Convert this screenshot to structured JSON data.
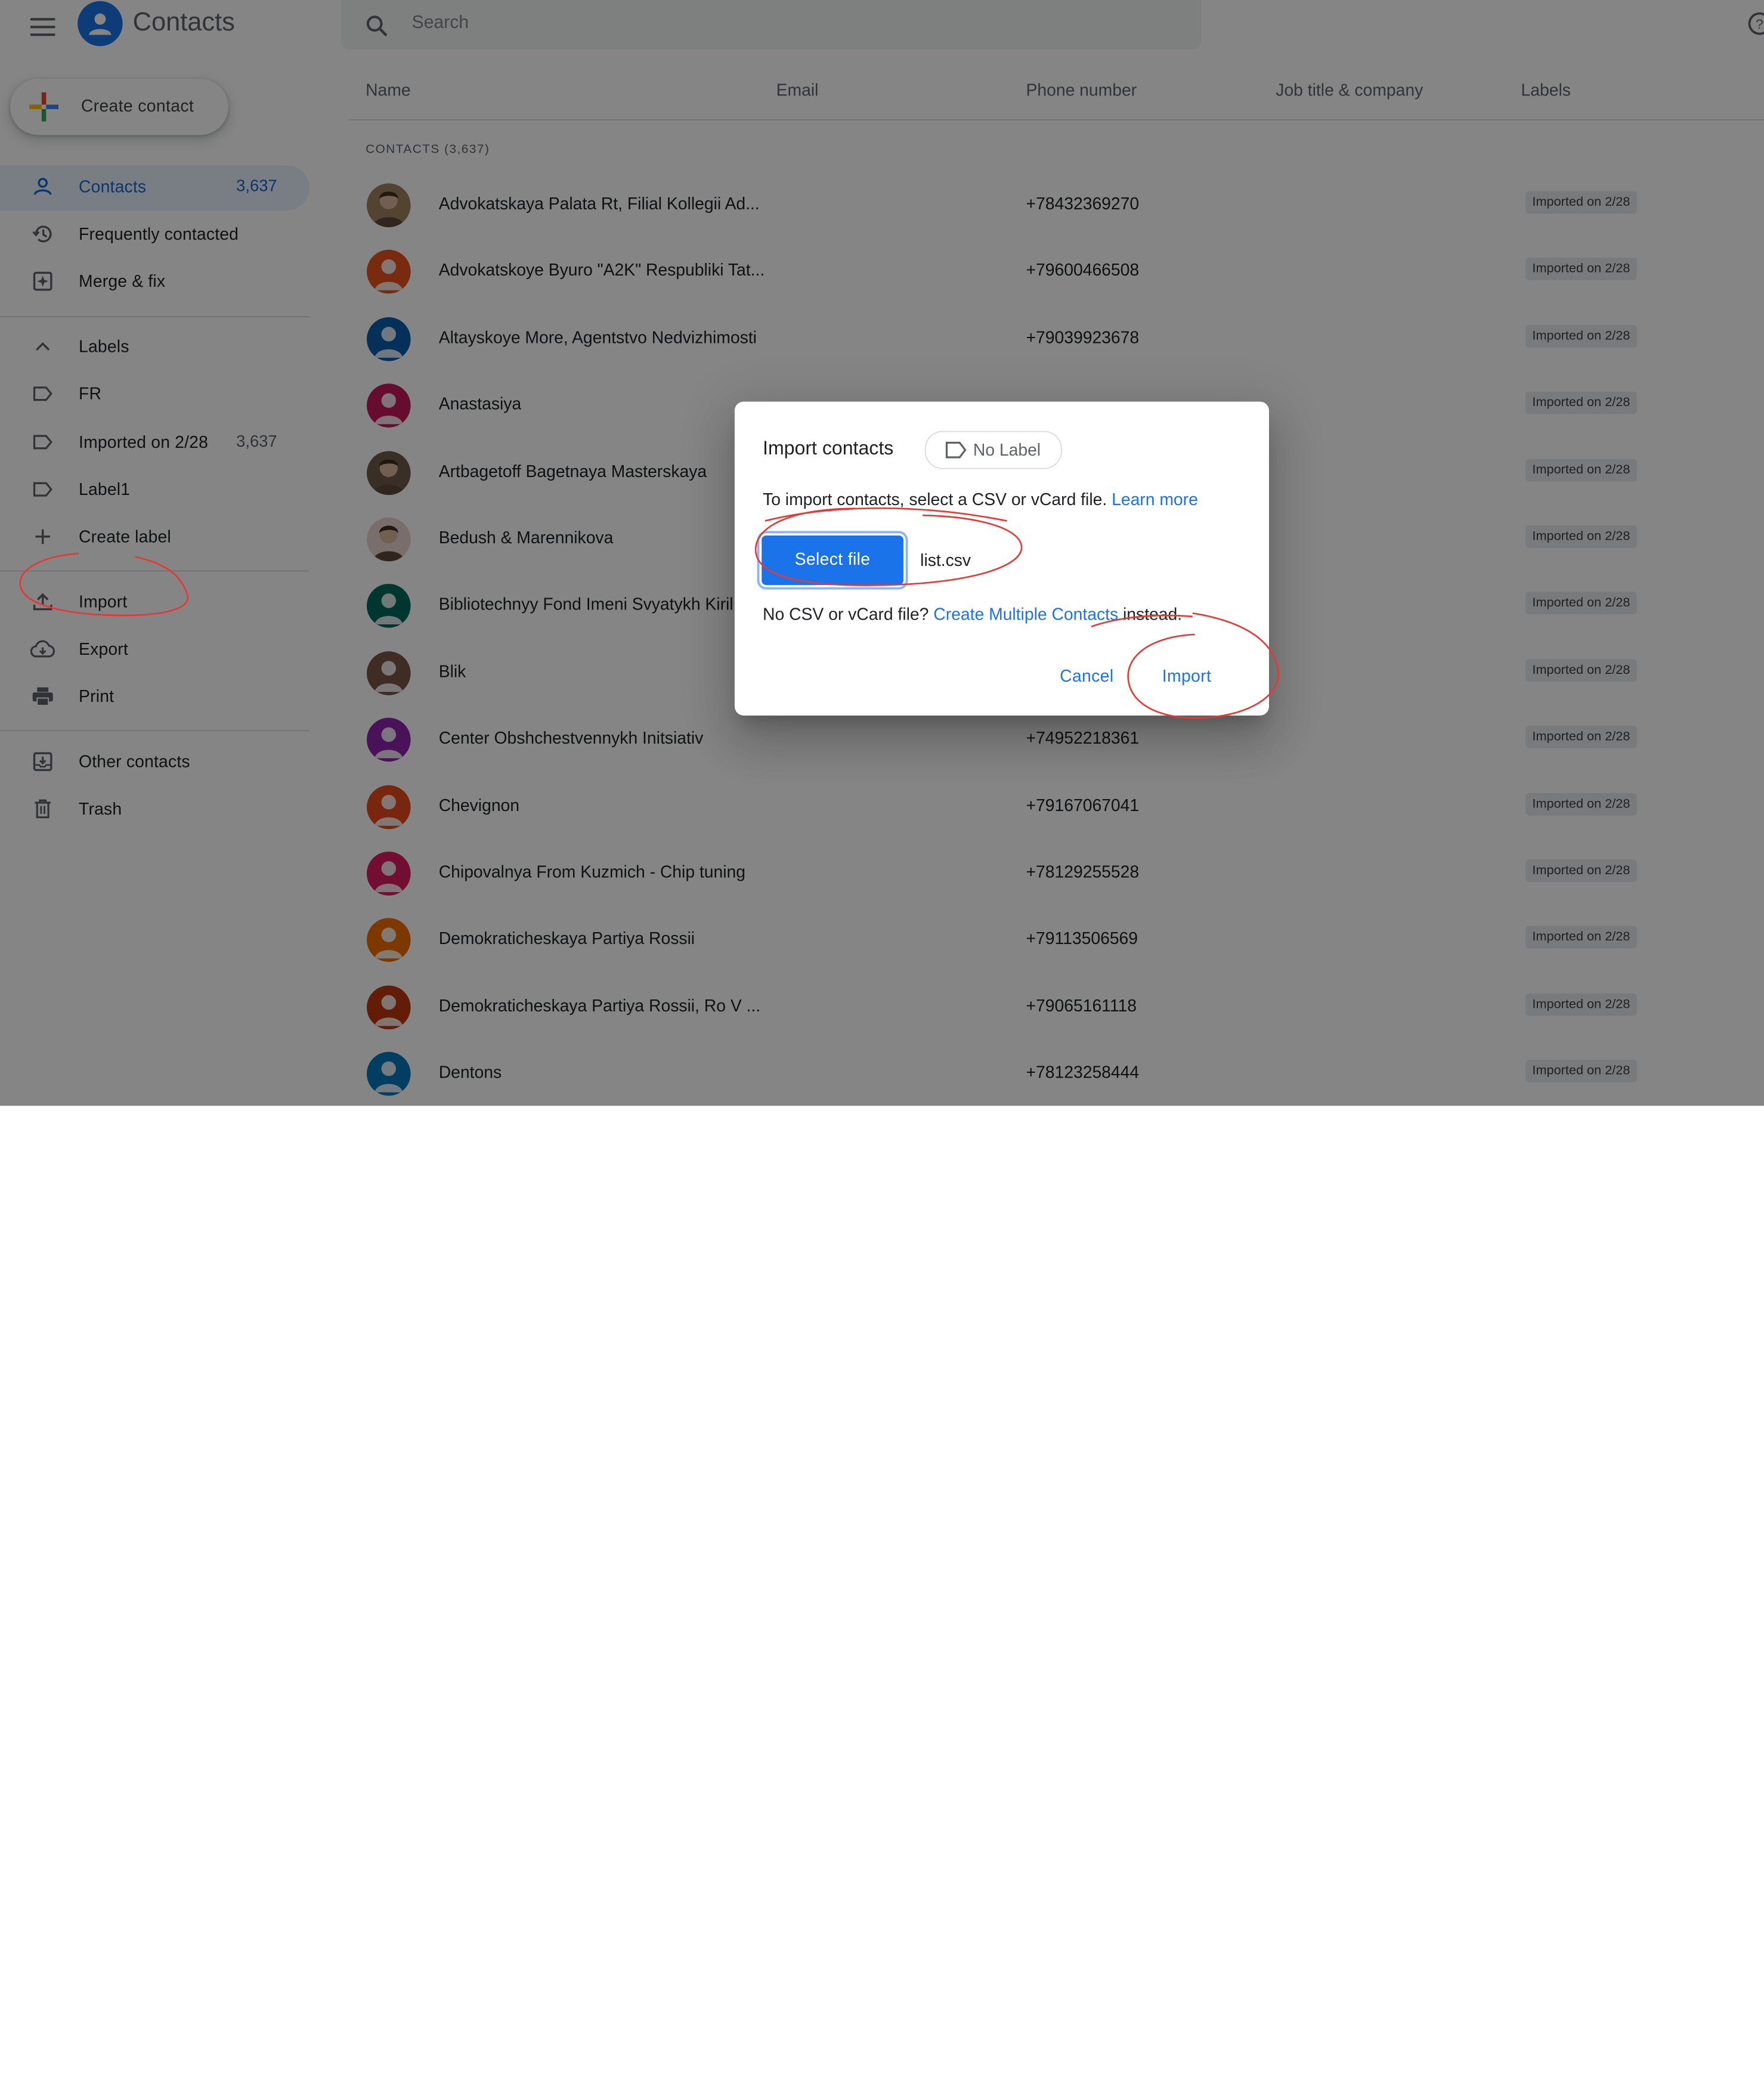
{
  "header": {
    "app_title": "Contacts",
    "search_placeholder": "Search",
    "icons": [
      "menu-icon",
      "contacts-logo-icon",
      "search-icon",
      "help-icon"
    ]
  },
  "sidebar": {
    "create_contact": "Create contact",
    "items": [
      {
        "label": "Contacts",
        "count": "3,637",
        "icon": "person-icon",
        "active": true
      },
      {
        "label": "Frequently contacted",
        "icon": "history-icon"
      },
      {
        "label": "Merge & fix",
        "icon": "merge-icon"
      }
    ],
    "labels_header": "Labels",
    "labels": [
      {
        "label": "FR",
        "icon": "label-icon"
      },
      {
        "label": "Imported on 2/28",
        "count": "3,637",
        "icon": "label-icon"
      },
      {
        "label": "Label1",
        "icon": "label-icon"
      }
    ],
    "create_label": "Create label",
    "actions": [
      {
        "label": "Import",
        "icon": "upload-icon"
      },
      {
        "label": "Export",
        "icon": "cloud-download-icon"
      },
      {
        "label": "Print",
        "icon": "printer-icon"
      }
    ],
    "other": [
      {
        "label": "Other contacts",
        "icon": "inbox-icon"
      },
      {
        "label": "Trash",
        "icon": "trash-icon"
      }
    ]
  },
  "main": {
    "columns": [
      "Name",
      "Email",
      "Phone number",
      "Job title & company",
      "Labels"
    ],
    "section_label": "CONTACTS (3,637)",
    "rows": [
      {
        "name": "Advokatskaya Palata Rt, Filial Kollegii Ad...",
        "phone": "+78432369270",
        "label": "Imported on 2/28",
        "avatar": "photo",
        "color": "#9e8063"
      },
      {
        "name": "Advokatskoye Byuro \"A2K\" Respubliki Tat...",
        "phone": "+79600466508",
        "label": "Imported on 2/28",
        "avatar": "initial",
        "color": "#e8541e"
      },
      {
        "name": "Altayskoye More, Agentstvo Nedvizhimosti",
        "phone": "+79039923678",
        "label": "Imported on 2/28",
        "avatar": "initial",
        "color": "#0b5cab"
      },
      {
        "name": "Anastasiya",
        "phone": "",
        "label": "Imported on 2/28",
        "avatar": "initial",
        "color": "#c2185b"
      },
      {
        "name": "Artbagetoff Bagetnaya Masterskaya",
        "phone": "",
        "label": "Imported on 2/28",
        "avatar": "photo",
        "color": "#6d5a4b"
      },
      {
        "name": "Bedush & Marennikova",
        "phone": "",
        "label": "Imported on 2/28",
        "avatar": "photo",
        "color": "#e9d3cf"
      },
      {
        "name": "Bibliotechnyy Fond Imeni Svyatykh Kiril",
        "phone": "",
        "label": "Imported on 2/28",
        "avatar": "initial",
        "color": "#00695c"
      },
      {
        "name": "Blik",
        "phone": "",
        "label": "Imported on 2/28",
        "avatar": "initial",
        "color": "#795548"
      },
      {
        "name": "Center Obshchestvennykh Initsiativ",
        "phone": "+74952218361",
        "label": "Imported on 2/28",
        "avatar": "initial",
        "color": "#8e24aa"
      },
      {
        "name": "Chevignon",
        "phone": "+79167067041",
        "label": "Imported on 2/28",
        "avatar": "initial",
        "color": "#e64a19"
      },
      {
        "name": "Chipovalnya From Kuzmich - Chip tuning",
        "phone": "+78129255528",
        "label": "Imported on 2/28",
        "avatar": "initial",
        "color": "#d81b60"
      },
      {
        "name": "Demokraticheskaya Partiya Rossii",
        "phone": "+79113506569",
        "label": "Imported on 2/28",
        "avatar": "initial",
        "color": "#ef6c00"
      },
      {
        "name": "Demokraticheskaya Partiya Rossii, Ro V ...",
        "phone": "+79065161118",
        "label": "Imported on 2/28",
        "avatar": "initial",
        "color": "#bf360c"
      },
      {
        "name": "Dentons",
        "phone": "+78123258444",
        "label": "Imported on 2/28",
        "avatar": "initial",
        "color": "#0277bd"
      }
    ]
  },
  "dialog": {
    "title": "Import contacts",
    "label_chip": "No Label",
    "instructions": "To import contacts, select a CSV or vCard file.",
    "learn_more": "Learn more",
    "select_file": "Select file",
    "file_name": "list.csv",
    "alt_prefix": "No CSV or vCard file?",
    "alt_link": "Create Multiple Contacts",
    "alt_suffix": "instead.",
    "cancel": "Cancel",
    "import": "Import"
  },
  "colors": {
    "accent": "#1a73e8",
    "annotation": "#e53935",
    "scrim": "rgba(0,0,0,0.48)"
  }
}
